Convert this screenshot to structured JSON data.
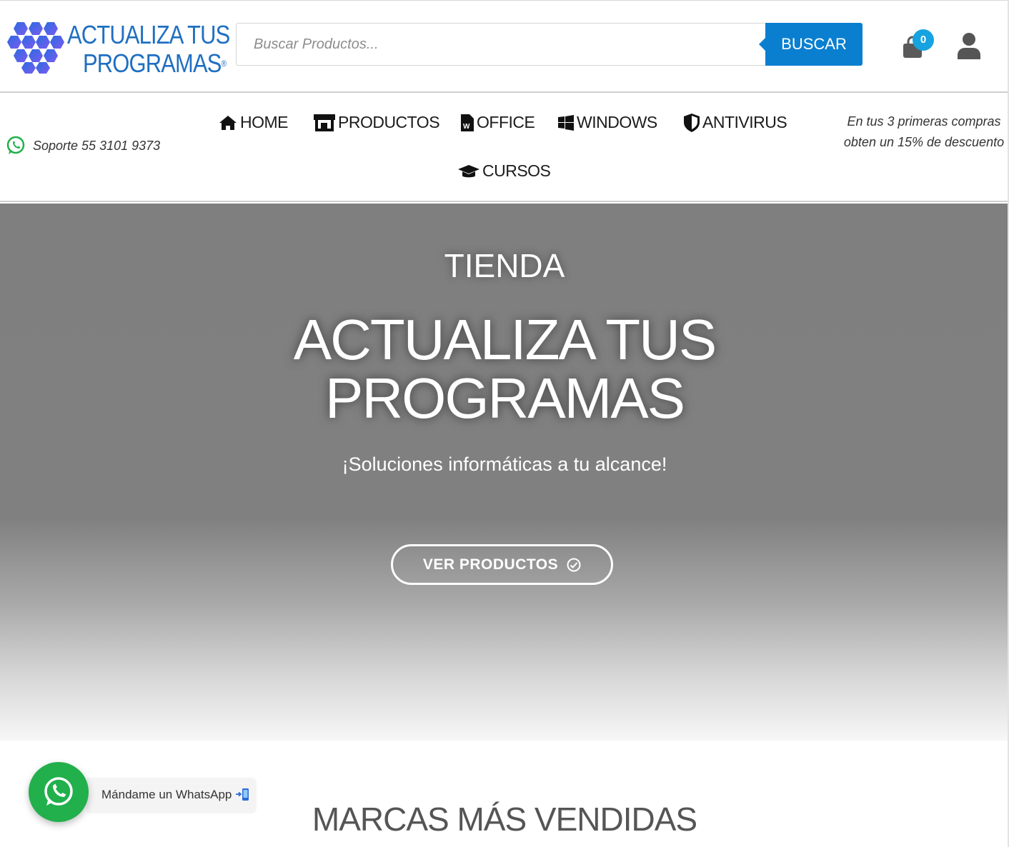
{
  "header": {
    "logo": {
      "line1": "ACTUALIZA TUS",
      "line2": "PROGRAMAS",
      "registered": "®"
    },
    "search": {
      "placeholder": "Buscar Productos...",
      "value": "",
      "button_label": "BUSCAR"
    },
    "cart": {
      "count": "0",
      "icon": "shopping-bag-icon"
    },
    "account": {
      "icon": "user-icon"
    }
  },
  "nav": {
    "support": {
      "icon": "whatsapp-icon",
      "label": "Soporte 55 3101 9373"
    },
    "items": [
      {
        "label": "HOME",
        "icon": "home-icon"
      },
      {
        "label": "PRODUCTOS",
        "icon": "store-icon"
      },
      {
        "label": "OFFICE",
        "icon": "word-document-icon"
      },
      {
        "label": "WINDOWS",
        "icon": "windows-icon"
      },
      {
        "label": "ANTIVIRUS",
        "icon": "shield-icon"
      },
      {
        "label": "CURSOS",
        "icon": "graduation-cap-icon"
      }
    ],
    "promo": "En tus 3 primeras compras obten un 15% de descuento"
  },
  "hero": {
    "kicker": "TIENDA",
    "title_line1": "ACTUALIZA TUS",
    "title_line2": "PROGRAMAS",
    "subtitle": "¡Soluciones informáticas a tu alcance!",
    "cta_label": "VER PRODUCTOS",
    "cta_icon": "check-circle-icon"
  },
  "sections": {
    "brands_title": "MARCAS MÁS VENDIDAS"
  },
  "whatsapp_widget": {
    "label": "Mándame un WhatsApp",
    "icon": "whatsapp-icon",
    "emoji_icon": "mobile-phone-arrow-icon"
  },
  "colors": {
    "brand_blue": "#1f6fc1",
    "button_blue": "#0a7fd0",
    "badge_blue": "#16a3e0",
    "whatsapp_green": "#21b04b",
    "hero_gray": "#808080"
  }
}
